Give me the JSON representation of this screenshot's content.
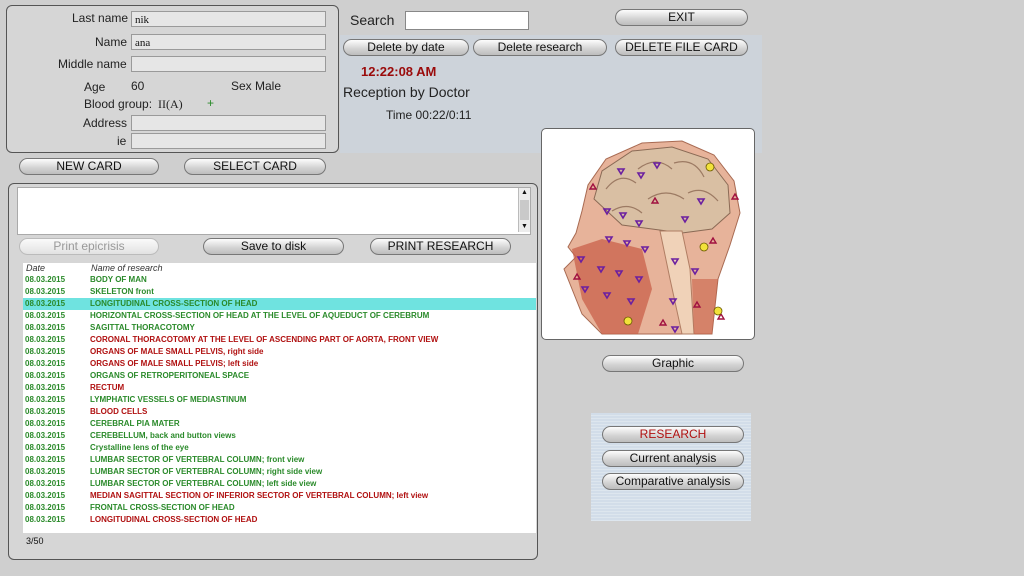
{
  "patient": {
    "last_name_label": "Last name",
    "last_name_value": "nik",
    "name_label": "Name",
    "name_value": "ana",
    "middle_name_label": "Middle name",
    "middle_name_value": "",
    "age_label": "Age",
    "age_value": "60",
    "sex_label": "Sex",
    "sex_value": "Male",
    "blood_label": "Blood group:",
    "blood_value": "II(A)",
    "rh_value": "+",
    "address_label": "Address",
    "address_value": "",
    "ie_label": "ie",
    "ie_value": ""
  },
  "card_buttons": {
    "new": "NEW CARD",
    "select": "SELECT CARD"
  },
  "search": {
    "label": "Search",
    "value": ""
  },
  "top_buttons": {
    "exit": "EXIT",
    "delete_by_date": "Delete by date",
    "delete_research": "Delete research",
    "delete_file_card": "DELETE FILE CARD"
  },
  "status": {
    "clock": "12:22:08 AM",
    "reception": "Reception by Doctor",
    "time": "Time 00:22/0:11"
  },
  "research_buttons": {
    "print_epicrisis": "Print epicrisis",
    "save_to_disk": "Save to disk",
    "print_research": "PRINT RESEARCH"
  },
  "list": {
    "col_date": "Date",
    "col_name": "Name of research",
    "rows": [
      {
        "date": "08.03.2015",
        "name": "BODY OF MAN",
        "tone": "g"
      },
      {
        "date": "08.03.2015",
        "name": "SKELETON front",
        "tone": "g"
      },
      {
        "date": "08.03.2015",
        "name": "LONGITUDINAL CROSS-SECTION OF HEAD",
        "tone": "sel"
      },
      {
        "date": "08.03.2015",
        "name": "HORIZONTAL CROSS-SECTION OF HEAD AT THE LEVEL OF AQUEDUCT OF CEREBRUM",
        "tone": "g"
      },
      {
        "date": "08.03.2015",
        "name": "SAGITTAL THORACOTOMY",
        "tone": "g"
      },
      {
        "date": "08.03.2015",
        "name": "CORONAL THORACOTOMY AT THE LEVEL OF ASCENDING PART OF AORTA, FRONT VIEW",
        "tone": "r"
      },
      {
        "date": "08.03.2015",
        "name": "ORGANS OF MALE SMALL PELVIS, right side",
        "tone": "r"
      },
      {
        "date": "08.03.2015",
        "name": "ORGANS OF MALE SMALL PELVIS; left side",
        "tone": "r"
      },
      {
        "date": "08.03.2015",
        "name": "ORGANS OF RETROPERITONEAL SPACE",
        "tone": "g"
      },
      {
        "date": "08.03.2015",
        "name": "RECTUM",
        "tone": "r"
      },
      {
        "date": "08.03.2015",
        "name": "LYMPHATIC VESSELS OF MEDIASTINUM",
        "tone": "g"
      },
      {
        "date": "08.03.2015",
        "name": "BLOOD CELLS",
        "tone": "r"
      },
      {
        "date": "08.03.2015",
        "name": "CEREBRAL PIA MATER",
        "tone": "g"
      },
      {
        "date": "08.03.2015",
        "name": "CEREBELLUM, back and button views",
        "tone": "g"
      },
      {
        "date": "08.03.2015",
        "name": "Crystalline lens of the eye",
        "tone": "g"
      },
      {
        "date": "08.03.2015",
        "name": "LUMBAR SECTOR OF VERTEBRAL COLUMN; front view",
        "tone": "g"
      },
      {
        "date": "08.03.2015",
        "name": "LUMBAR SECTOR OF VERTEBRAL COLUMN; right side view",
        "tone": "g"
      },
      {
        "date": "08.03.2015",
        "name": "LUMBAR SECTOR OF VERTEBRAL COLUMN; left side view",
        "tone": "g"
      },
      {
        "date": "08.03.2015",
        "name": "MEDIAN SAGITTAL SECTION OF INFERIOR SECTOR OF VERTEBRAL COLUMN; left view",
        "tone": "r"
      },
      {
        "date": "08.03.2015",
        "name": "FRONTAL CROSS-SECTION OF HEAD",
        "tone": "g"
      },
      {
        "date": "08.03.2015",
        "name": "LONGITUDINAL CROSS-SECTION OF HEAD",
        "tone": "r"
      }
    ],
    "footer": "3/50"
  },
  "analysis": {
    "graphic": "Graphic",
    "research": "RESEARCH",
    "current": "Current analysis",
    "comparative": "Comparative analysis"
  },
  "colors": {
    "accent_red": "#b01010",
    "list_green": "#2a8a2a",
    "selected_row": "#6fe3e0",
    "marker_purple": "#6b1fa0"
  },
  "image": {
    "icon": "anatomy-head-cross-section-icon"
  }
}
